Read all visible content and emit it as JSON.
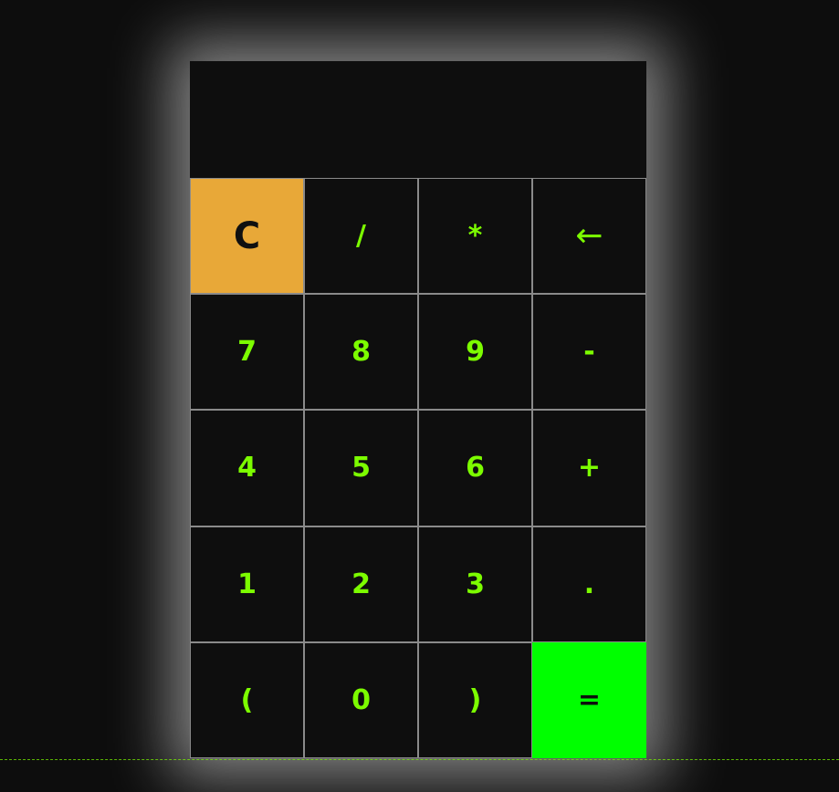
{
  "display": {
    "value": ""
  },
  "keys": {
    "clear": "C",
    "divide": "/",
    "multiply": "*",
    "backspace": "←",
    "seven": "7",
    "eight": "8",
    "nine": "9",
    "minus": "-",
    "four": "4",
    "five": "5",
    "six": "6",
    "plus": "+",
    "one": "1",
    "two": "2",
    "three": "3",
    "decimal": ".",
    "open_paren": "(",
    "zero": "0",
    "close_paren": ")",
    "equals": "="
  },
  "colors": {
    "page_background": "#0d0d0d",
    "key_background": "#0e0e0e",
    "key_text": "#7cfc00",
    "clear_background": "#e8a838",
    "equals_background": "#00ff00",
    "key_border": "#8a8a8a"
  }
}
